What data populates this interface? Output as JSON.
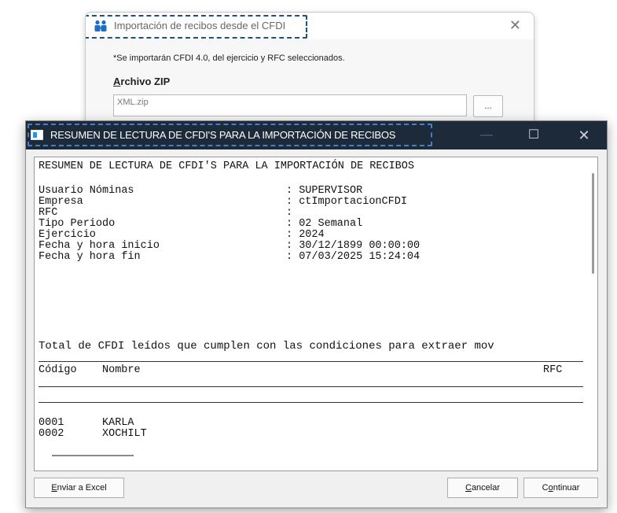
{
  "import_dialog": {
    "title": "Importación de recibos desde el CFDI",
    "close_icon": "close-icon",
    "note": "*Se importarán CFDI 4.0, del ejercicio y RFC seleccionados.",
    "zip_label_access": "A",
    "zip_label_rest": "rchivo ZIP",
    "zip_value": "XML.zip",
    "browse_label": "..."
  },
  "summary_window": {
    "title": "RESUMEN DE LECTURA DE CFDI'S PARA LA IMPORTACIÓN DE RECIBOS",
    "minimize": "—",
    "maximize": "☐",
    "close": "✕"
  },
  "report": {
    "heading": "RESUMEN DE LECTURA DE CFDI'S PARA LA IMPORTACIÓN DE RECIBOS",
    "fields": [
      {
        "label": "Usuario Nóminas",
        "value": ": SUPERVISOR"
      },
      {
        "label": "Empresa",
        "value": ": ctImportacionCFDI"
      },
      {
        "label": "RFC",
        "value": ":"
      },
      {
        "label": "Tipo Periodo",
        "value": ": 02 Semanal"
      },
      {
        "label": "Ejercicio",
        "value": ": 2024"
      },
      {
        "label": "Fecha y hora inicio",
        "value": ": 30/12/1899 00:00:00"
      },
      {
        "label": "Fecha y hora fin",
        "value": ": 07/03/2025 15:24:04"
      }
    ],
    "total_line": "Total de CFDI leídos que cumplen con las condiciones para extraer mov",
    "columns": {
      "codigo": "Código",
      "nombre": "Nombre",
      "rfc": "RFC"
    },
    "rows": [
      {
        "codigo": "0001",
        "nombre": "KARLA"
      },
      {
        "codigo": "0002",
        "nombre": "XOCHILT"
      }
    ]
  },
  "buttons": {
    "excel_access": "E",
    "excel_rest": "nviar a Excel",
    "cancel_access": "C",
    "cancel_rest": "ancelar",
    "continue_pre": "C",
    "continue_access": "o",
    "continue_rest": "ntinuar"
  }
}
